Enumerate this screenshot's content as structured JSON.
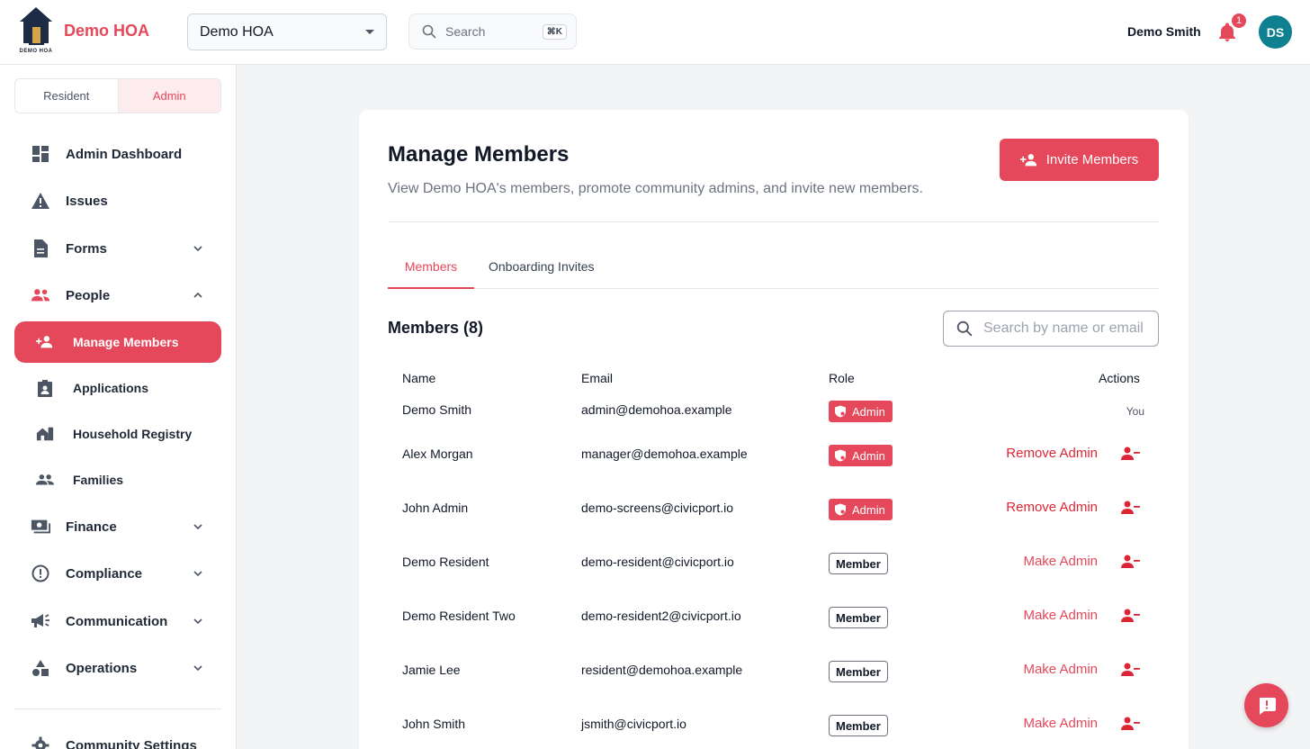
{
  "header": {
    "logo_caption": "DEMO HOA",
    "brand_name": "Demo HOA",
    "org_select_value": "Demo HOA",
    "search_placeholder": "Search",
    "search_shortcut": "⌘K",
    "user_name": "Demo Smith",
    "notification_count": "1",
    "avatar_initials": "DS"
  },
  "sidebar": {
    "mode_resident": "Resident",
    "mode_admin": "Admin",
    "active_mode": "Admin",
    "items": {
      "dashboard": "Admin Dashboard",
      "issues": "Issues",
      "forms": "Forms",
      "people": "People",
      "manage_members": "Manage Members",
      "applications": "Applications",
      "household_registry": "Household Registry",
      "families": "Families",
      "finance": "Finance",
      "compliance": "Compliance",
      "communication": "Communication",
      "operations": "Operations",
      "community_settings": "Community Settings"
    }
  },
  "main": {
    "title": "Manage Members",
    "subtitle": "View Demo HOA's members, promote community admins, and invite new members.",
    "invite_label": "Invite Members",
    "tabs": [
      {
        "label": "Members",
        "active": true
      },
      {
        "label": "Onboarding Invites",
        "active": false
      }
    ],
    "members_heading": "Members (8)",
    "search_placeholder": "Search by name or email",
    "columns": {
      "name": "Name",
      "email": "Email",
      "role": "Role",
      "actions": "Actions"
    },
    "rows": [
      {
        "name": "Demo Smith",
        "email": "admin@demohoa.example",
        "role": "Admin",
        "action": "You"
      },
      {
        "name": "Alex Morgan",
        "email": "manager@demohoa.example",
        "role": "Admin",
        "action": "Remove Admin"
      },
      {
        "name": "John Admin",
        "email": "demo-screens@civicport.io",
        "role": "Admin",
        "action": "Remove Admin"
      },
      {
        "name": "Demo Resident",
        "email": "demo-resident@civicport.io",
        "role": "Member",
        "action": "Make Admin"
      },
      {
        "name": "Demo Resident Two",
        "email": "demo-resident2@civicport.io",
        "role": "Member",
        "action": "Make Admin"
      },
      {
        "name": "Jamie Lee",
        "email": "resident@demohoa.example",
        "role": "Member",
        "action": "Make Admin"
      },
      {
        "name": "John Smith",
        "email": "jsmith@civicport.io",
        "role": "Member",
        "action": "Make Admin"
      }
    ]
  },
  "colors": {
    "accent": "#e5485a",
    "danger": "#dc2635",
    "avatar": "#0e8090",
    "nav_icon": "#4b5563"
  }
}
